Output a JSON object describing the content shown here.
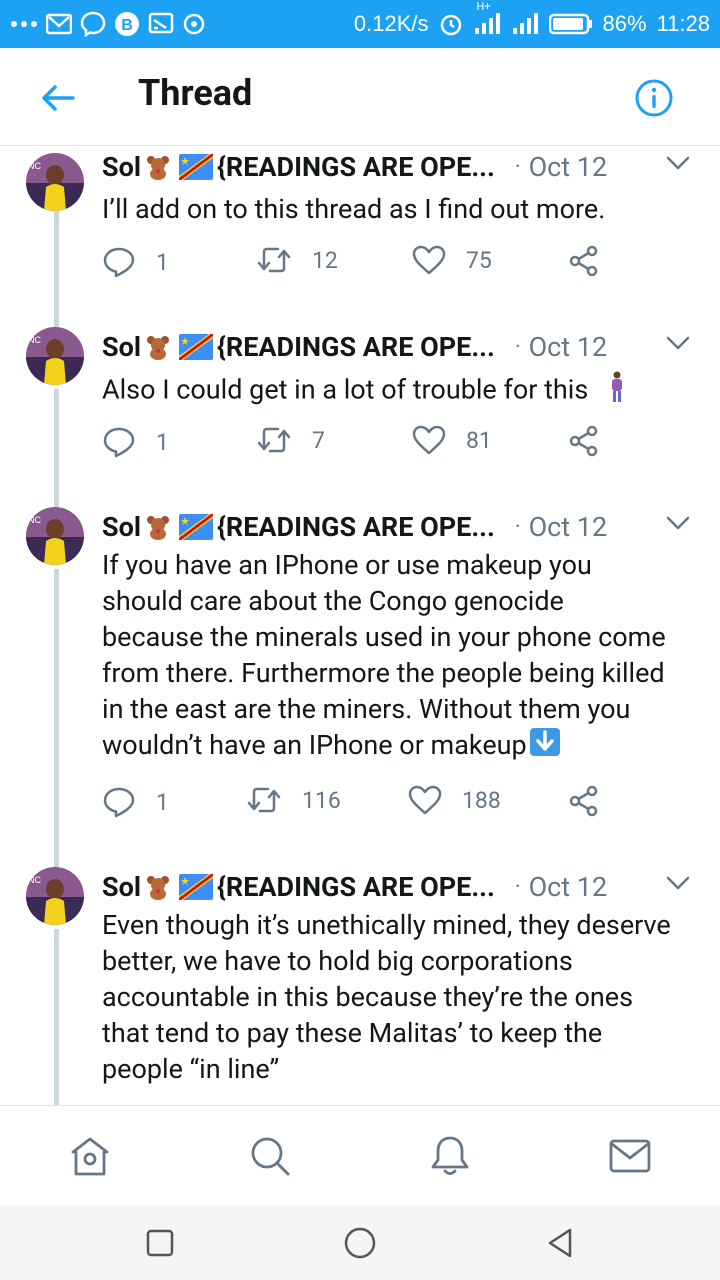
{
  "status_bar": {
    "network_speed": "0.12K/s",
    "battery": "86%",
    "time": "11:28",
    "network_type": "H+"
  },
  "header": {
    "title": "Thread"
  },
  "tweets": [
    {
      "name": "Sol",
      "display_suffix": "{READINGS ARE OPE...",
      "separator": "·",
      "date": "Oct 12",
      "text": "I’ll add on to this thread as I find out more.",
      "replies": "1",
      "retweets": "12",
      "likes": "75"
    },
    {
      "name": "Sol",
      "display_suffix": "{READINGS ARE OPE...",
      "separator": "·",
      "date": "Oct 12",
      "text": "Also I could get in a lot of trouble for this",
      "replies": "1",
      "retweets": "7",
      "likes": "81"
    },
    {
      "name": "Sol",
      "display_suffix": "{READINGS ARE OPE...",
      "separator": "·",
      "date": "Oct 12",
      "text_lines": [
        "If you have an IPhone or use makeup you",
        "should care about the Congo genocide",
        "because the minerals used in your phone come",
        "from there. Furthermore the people being killed",
        "in the east are the miners. Without them you",
        "wouldn’t have an IPhone or makeup"
      ],
      "replies": "1",
      "retweets": "116",
      "likes": "188"
    },
    {
      "name": "Sol",
      "display_suffix": "{READINGS ARE OPE...",
      "separator": "·",
      "date": "Oct 12",
      "text_lines": [
        "Even though it’s unethically mined, they deserve",
        "better, we have to hold big corporations",
        "accountable in this because they’re the ones",
        "that tend to pay these Malitas’ to keep the",
        "people “in line”"
      ]
    }
  ],
  "icons": {
    "back": "arrow-left-icon",
    "info": "info-icon",
    "reply": "reply-icon",
    "retweet": "retweet-icon",
    "like": "heart-icon",
    "share": "share-icon",
    "home": "home-icon",
    "search": "search-icon",
    "notifications": "bell-icon",
    "messages": "mail-icon"
  },
  "colors": {
    "accent": "#1da1f2",
    "text": "#14171a",
    "muted": "#657786",
    "divider": "#e1e8ed",
    "thread_line": "#ccd6dd"
  }
}
